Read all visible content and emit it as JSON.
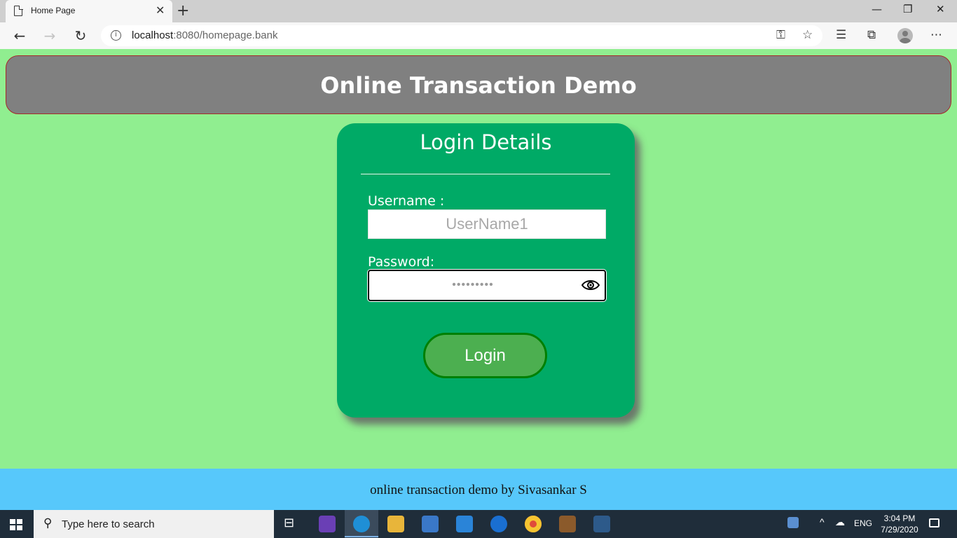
{
  "browser": {
    "tab_title": "Home Page",
    "tab_close": "✕",
    "new_tab": "+",
    "url_host": "localhost",
    "url_rest": ":8080/homepage.bank",
    "win_min": "—",
    "win_restore": "❐",
    "win_close": "✕"
  },
  "page": {
    "header_title": "Online Transaction Demo",
    "login_title": "Login Details",
    "username_label": "Username :",
    "username_placeholder": "UserName1",
    "password_label": "Password:",
    "password_value": "•••••••••",
    "login_button": "Login",
    "footer_text": "online transaction demo by Sivasankar S"
  },
  "taskbar": {
    "search_placeholder": "Type here to search",
    "language": "ENG",
    "time": "3:04 PM",
    "date": "7/29/2020"
  },
  "colors": {
    "page_bg": "#90ee90",
    "header_bg": "#808080",
    "card_bg": "#00aa66",
    "button_bg": "#4caf50",
    "footer_bg": "#57c8fb"
  }
}
